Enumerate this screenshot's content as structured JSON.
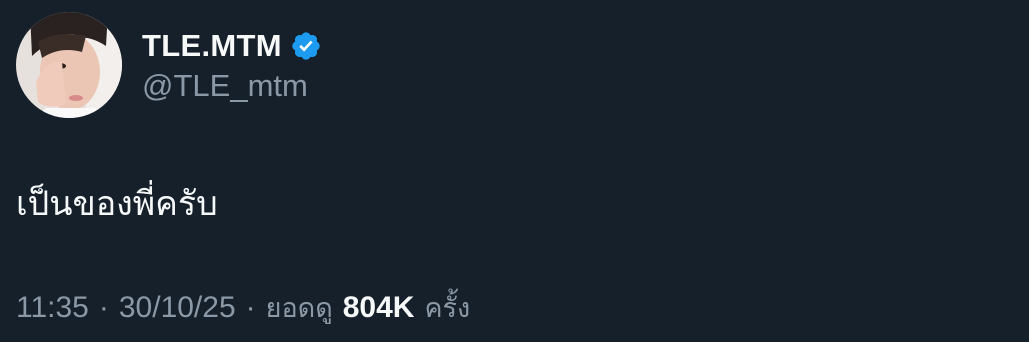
{
  "author": {
    "display_name": "TLE.MTM",
    "handle": "@TLE_mtm",
    "verified": true,
    "verified_color": "#1d9bf0"
  },
  "tweet": {
    "text": "เป็นของพี่ครับ"
  },
  "meta": {
    "time": "11:35",
    "separator": "·",
    "date": "30/10/25",
    "views_label": "ยอดดู",
    "views_count": "804K",
    "views_suffix": "ครั้ง"
  },
  "colors": {
    "background": "#15202b",
    "primary_text": "#f7f9f9",
    "secondary_text": "#8b98a5"
  }
}
